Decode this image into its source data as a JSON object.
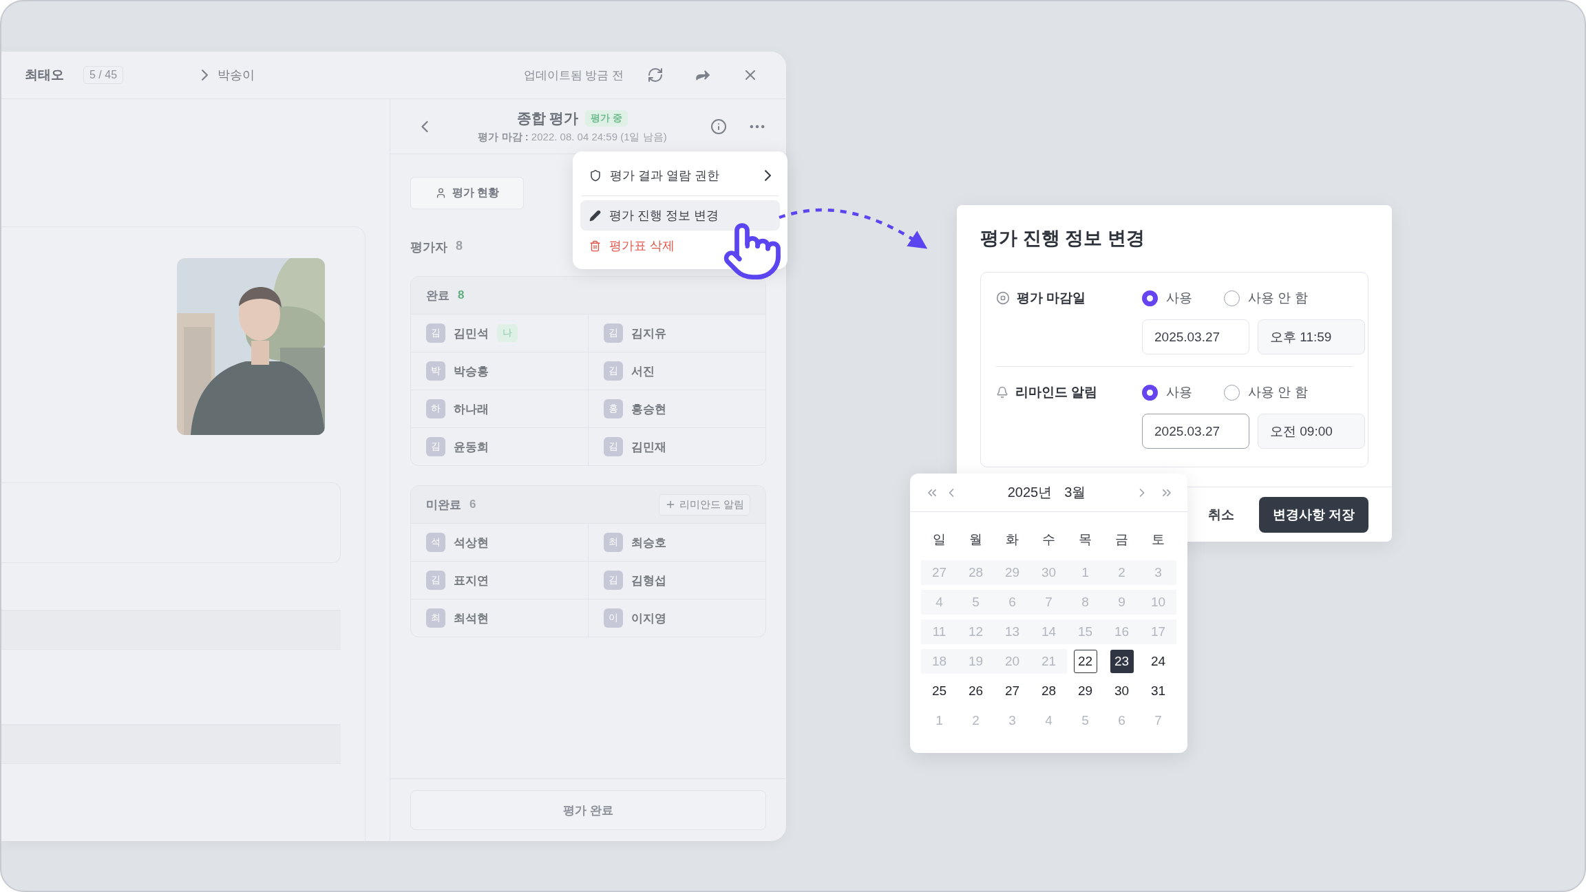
{
  "window": {
    "name": "최태오",
    "counter": "5 / 45",
    "current": "박송이",
    "status": "업데이트됨 방금 전"
  },
  "evaluation": {
    "title": "종합 평가",
    "badge": "평가 중",
    "deadline": "**평가 마감 :**  2022. 08. 04 24:59 (1일 남음)"
  },
  "tabs": [
    {
      "label": "평가 현황",
      "selected": true
    }
  ],
  "evaluators": {
    "label": "평가자",
    "count": "8"
  },
  "groups": [
    {
      "kind": "complete",
      "label": "완료",
      "count": "8",
      "members": [
        {
          "initial": "김",
          "name": "김민석",
          "badge": "나"
        },
        {
          "initial": "김",
          "name": "김지유"
        },
        {
          "initial": "박",
          "name": "박승홍"
        },
        {
          "initial": "김",
          "name": "서진"
        },
        {
          "initial": "하",
          "name": "하나래"
        },
        {
          "initial": "홍",
          "name": "홍승현"
        },
        {
          "initial": "김",
          "name": "윤동희"
        },
        {
          "initial": "김",
          "name": "김민재"
        }
      ]
    },
    {
      "kind": "incomplete",
      "label": "미완료",
      "count": "6",
      "action": "리미안드 알림",
      "members": [
        {
          "initial": "석",
          "name": "석상현"
        },
        {
          "initial": "최",
          "name": "최승호"
        },
        {
          "initial": "김",
          "name": "표지연"
        },
        {
          "initial": "김",
          "name": "김형섭"
        },
        {
          "initial": "최",
          "name": "최석현"
        },
        {
          "initial": "이",
          "name": "이지영"
        }
      ]
    }
  ],
  "footer_button": "평가 완료",
  "menu": {
    "items": [
      {
        "kind": "submenu",
        "label": "평가 결과 열람 권한",
        "selected": false
      },
      {
        "kind": "edit",
        "label": "평가 진행 정보 변경",
        "selected": true
      },
      {
        "kind": "danger",
        "label": "평가표 삭제",
        "selected": false
      }
    ]
  },
  "dialog": {
    "title": "평가 진행 정보 변경",
    "settings": [
      {
        "kind": "deadline",
        "label": "평가 마감일",
        "options": [
          {
            "label": "사용",
            "selected": true
          },
          {
            "label": "사용 안 함",
            "selected": false
          }
        ],
        "date": "2025.03.27",
        "time": "오후 11:59",
        "focused": false
      },
      {
        "kind": "reminder",
        "label": "리마인드 알림",
        "options": [
          {
            "label": "사용",
            "selected": true
          },
          {
            "label": "사용 안 함",
            "selected": false
          }
        ],
        "date": "2025.03.27",
        "time": "오전 09:00",
        "focused": true
      }
    ],
    "cancel": "취소",
    "save": "변경사항 저장"
  },
  "calendar": {
    "year": "2025년",
    "month": "3월",
    "weekdays": [
      "일",
      "월",
      "화",
      "수",
      "목",
      "금",
      "토"
    ],
    "weeks": [
      [
        {
          "day": "27",
          "kind": "disabled"
        },
        {
          "day": "28",
          "kind": "disabled"
        },
        {
          "day": "29",
          "kind": "disabled"
        },
        {
          "day": "30",
          "kind": "disabled"
        },
        {
          "day": "1",
          "kind": "disabled"
        },
        {
          "day": "2",
          "kind": "disabled"
        },
        {
          "day": "3",
          "kind": "disabled"
        }
      ],
      [
        {
          "day": "4",
          "kind": "disabled"
        },
        {
          "day": "5",
          "kind": "disabled"
        },
        {
          "day": "6",
          "kind": "disabled"
        },
        {
          "day": "7",
          "kind": "disabled"
        },
        {
          "day": "8",
          "kind": "disabled"
        },
        {
          "day": "9",
          "kind": "disabled"
        },
        {
          "day": "10",
          "kind": "disabled"
        }
      ],
      [
        {
          "day": "11",
          "kind": "disabled"
        },
        {
          "day": "12",
          "kind": "disabled"
        },
        {
          "day": "13",
          "kind": "disabled"
        },
        {
          "day": "14",
          "kind": "disabled"
        },
        {
          "day": "15",
          "kind": "disabled"
        },
        {
          "day": "16",
          "kind": "disabled"
        },
        {
          "day": "17",
          "kind": "disabled"
        }
      ],
      [
        {
          "day": "18",
          "kind": "disabled"
        },
        {
          "day": "19",
          "kind": "disabled"
        },
        {
          "day": "20",
          "kind": "disabled"
        },
        {
          "day": "21",
          "kind": "disabled"
        },
        {
          "day": "22",
          "kind": "today"
        },
        {
          "day": "23",
          "kind": "selected"
        },
        {
          "day": "24",
          "kind": "normal"
        }
      ],
      [
        {
          "day": "25",
          "kind": "normal"
        },
        {
          "day": "26",
          "kind": "normal"
        },
        {
          "day": "27",
          "kind": "normal"
        },
        {
          "day": "28",
          "kind": "normal"
        },
        {
          "day": "29",
          "kind": "normal"
        },
        {
          "day": "30",
          "kind": "normal"
        },
        {
          "day": "31",
          "kind": "normal"
        }
      ],
      [
        {
          "day": "1",
          "kind": "outside"
        },
        {
          "day": "2",
          "kind": "outside"
        },
        {
          "day": "3",
          "kind": "outside"
        },
        {
          "day": "4",
          "kind": "outside"
        },
        {
          "day": "5",
          "kind": "outside"
        },
        {
          "day": "6",
          "kind": "outside"
        },
        {
          "day": "7",
          "kind": "outside"
        }
      ]
    ]
  }
}
